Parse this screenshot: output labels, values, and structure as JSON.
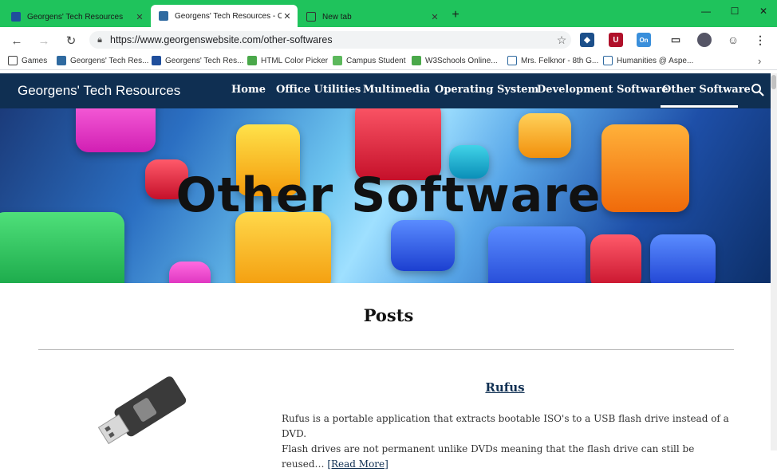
{
  "browser": {
    "tabs": [
      {
        "title": "Georgens' Tech Resources",
        "icon": "site-icon"
      },
      {
        "title": "Georgens' Tech Resources - Othe",
        "icon": "site-icon"
      },
      {
        "title": "New tab",
        "icon": "newtab-icon"
      }
    ],
    "active_tab": 1,
    "address": "https://www.georgenswebsite.com/other-softwares",
    "bookmarks": [
      {
        "label": "Games"
      },
      {
        "label": "Georgens' Tech Res..."
      },
      {
        "label": "Georgens' Tech Res..."
      },
      {
        "label": "HTML Color Picker"
      },
      {
        "label": "Campus Student"
      },
      {
        "label": "W3Schools Online..."
      },
      {
        "label": "Mrs. Felknor - 8th G..."
      },
      {
        "label": "Humanities @ Aspe..."
      }
    ],
    "extension_badge": "On"
  },
  "site": {
    "brand": "Georgens' Tech Resources",
    "menu": [
      {
        "label": "Home"
      },
      {
        "label": "Office Utilities"
      },
      {
        "label": "Multimedia"
      },
      {
        "label": "Operating System"
      },
      {
        "label": "Development Software"
      },
      {
        "label": "Other Software"
      }
    ],
    "active_menu": "Other Software"
  },
  "hero": {
    "title": "Other Software"
  },
  "posts": {
    "heading": "Posts",
    "items": [
      {
        "title": "Rufus",
        "excerpt_line1": "Rufus is a portable application that extracts bootable ISO's to a USB flash drive instead of a DVD.",
        "excerpt_line2": "Flash drives are not permanent unlike DVDs meaning that the flash drive can still be reused… ",
        "read_more": "[Read More]"
      }
    ]
  },
  "colors": {
    "tabstrip": "#1fc35c",
    "nav": "#0f2f52"
  }
}
